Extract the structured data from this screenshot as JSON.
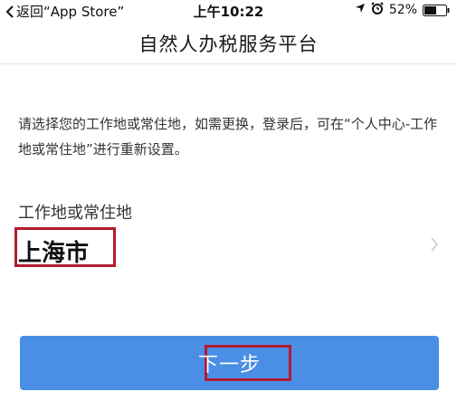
{
  "status_bar": {
    "back_label": "返回“App Store”",
    "time": "上午10:22",
    "battery_percent": "52%",
    "icons": [
      "location-arrow-icon",
      "alarm-icon",
      "battery-icon"
    ]
  },
  "nav": {
    "title": "自然人办税服务平台"
  },
  "content": {
    "intro": "请选择您的工作地或常住地，如需更换，登录后，可在“个人中心-工作地或常住地”进行重新设置。",
    "section_label": "工作地或常住地",
    "location_value": "上海市"
  },
  "actions": {
    "next_label": "下一步"
  },
  "colors": {
    "primary": "#4a8ee6",
    "highlight_border": "#b01c2e"
  }
}
